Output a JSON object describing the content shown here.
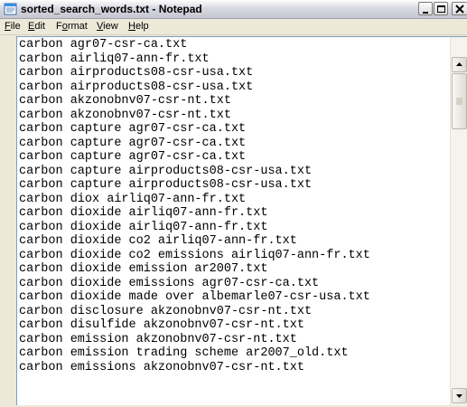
{
  "window": {
    "title": "sorted_search_words.txt - Notepad"
  },
  "menu": [
    {
      "label": "File",
      "accel": "F",
      "rest": "ile"
    },
    {
      "label": "Edit",
      "accel": "E",
      "rest": "dit"
    },
    {
      "label": "Format",
      "accel": "o",
      "pre": "F",
      "rest": "rmat"
    },
    {
      "label": "View",
      "accel": "V",
      "rest": "iew"
    },
    {
      "label": "Help",
      "accel": "H",
      "rest": "elp"
    }
  ],
  "document": {
    "lines": [
      "carbon agr07-csr-ca.txt",
      "carbon airliq07-ann-fr.txt",
      "carbon airproducts08-csr-usa.txt",
      "carbon airproducts08-csr-usa.txt",
      "carbon akzonobnv07-csr-nt.txt",
      "carbon akzonobnv07-csr-nt.txt",
      "carbon capture agr07-csr-ca.txt",
      "carbon capture agr07-csr-ca.txt",
      "carbon capture agr07-csr-ca.txt",
      "carbon capture airproducts08-csr-usa.txt",
      "carbon capture airproducts08-csr-usa.txt",
      "carbon diox airliq07-ann-fr.txt",
      "carbon dioxide airliq07-ann-fr.txt",
      "carbon dioxide airliq07-ann-fr.txt",
      "carbon dioxide co2 airliq07-ann-fr.txt",
      "carbon dioxide co2 emissions airliq07-ann-fr.txt",
      "carbon dioxide emission ar2007.txt",
      "carbon dioxide emissions agr07-csr-ca.txt",
      "carbon dioxide made over albemarle07-csr-usa.txt",
      "carbon disclosure akzonobnv07-csr-nt.txt",
      "carbon disulfide akzonobnv07-csr-nt.txt",
      "carbon emission akzonobnv07-csr-nt.txt",
      "carbon emission trading scheme ar2007_old.txt",
      "carbon emissions akzonobnv07-csr-nt.txt"
    ]
  },
  "scrollbar": {
    "position_fraction": 0.0
  }
}
